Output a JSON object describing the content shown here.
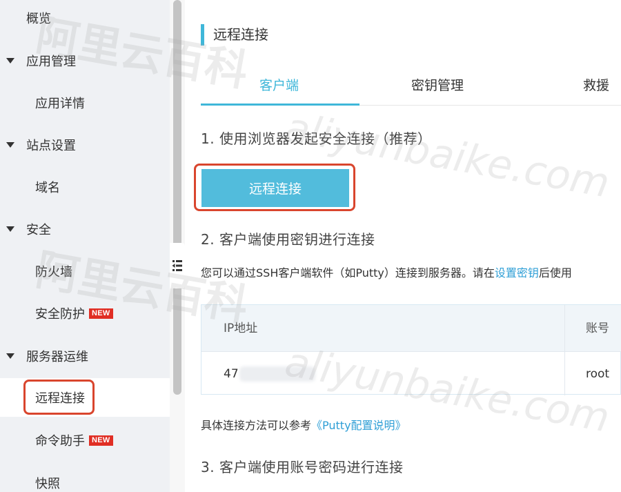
{
  "sidebar": {
    "items": [
      {
        "label": "概览",
        "type": "top"
      },
      {
        "label": "应用管理",
        "type": "group"
      },
      {
        "label": "应用详情",
        "type": "item"
      },
      {
        "label": "站点设置",
        "type": "group"
      },
      {
        "label": "域名",
        "type": "item"
      },
      {
        "label": "安全",
        "type": "group"
      },
      {
        "label": "防火墙",
        "type": "item"
      },
      {
        "label": "安全防护",
        "type": "item",
        "badge": "NEW"
      },
      {
        "label": "服务器运维",
        "type": "group"
      },
      {
        "label": "远程连接",
        "type": "item",
        "active": true
      },
      {
        "label": "命令助手",
        "type": "item",
        "badge": "NEW"
      },
      {
        "label": "快照",
        "type": "item"
      }
    ]
  },
  "main": {
    "title": "远程连接",
    "tabs": [
      {
        "label": "客户端",
        "active": true
      },
      {
        "label": "密钥管理"
      },
      {
        "label": "救援"
      }
    ],
    "section1": "1. 使用浏览器发起安全连接（推荐）",
    "connect_button": "远程连接",
    "section2": "2. 客户端使用密钥进行连接",
    "desc_prefix": "您可以通过SSH客户端软件（如Putty）连接到服务器。请在",
    "desc_link": "设置密钥",
    "desc_suffix": "后使用",
    "table": {
      "headers": [
        "IP地址",
        "账号"
      ],
      "rows": [
        [
          "47",
          "root"
        ]
      ]
    },
    "ref_prefix": "具体连接方法可以参考",
    "ref_link": "《Putty配置说明》",
    "section3": "3. 客户端使用账号密码进行连接"
  },
  "watermark": {
    "cn": "阿里云百科",
    "en": "aliyunbaike.com"
  },
  "colors": {
    "accent": "#3fb7d9",
    "highlight": "#d9452d",
    "badge": "#e02e24",
    "link": "#2f9fd6"
  }
}
